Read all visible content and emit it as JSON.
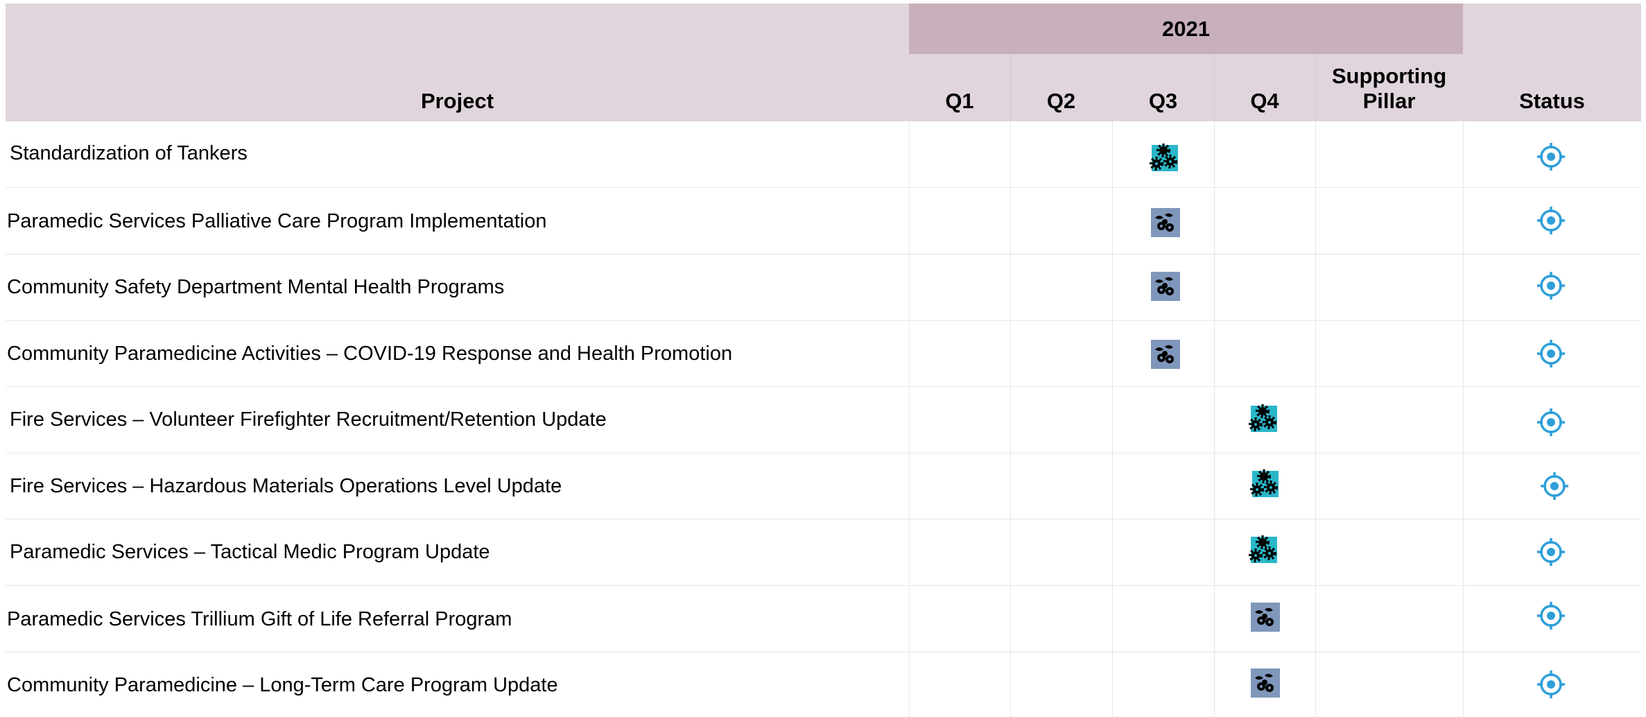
{
  "header": {
    "year": "2021",
    "project": "Project",
    "quarters": [
      "Q1",
      "Q2",
      "Q3",
      "Q4"
    ],
    "pillar_line1": "Supporting",
    "pillar_line2": "Pillar",
    "status": "Status"
  },
  "rows": [
    {
      "project": "Standardization of Tankers",
      "quarter": "Q3",
      "icon": "gears-icon"
    },
    {
      "project": "Paramedic Services Palliative Care Program Implementation",
      "quarter": "Q3",
      "icon": "people-care-icon"
    },
    {
      "project": "Community Safety Department Mental Health Programs",
      "quarter": "Q3",
      "icon": "people-care-icon"
    },
    {
      "project": "Community Paramedicine Activities – COVID-19 Response and Health Promotion",
      "quarter": "Q3",
      "icon": "people-care-icon"
    },
    {
      "project": "Fire Services – Volunteer Firefighter Recruitment/Retention Update",
      "quarter": "Q4",
      "icon": "gears-icon"
    },
    {
      "project": "Fire Services – Hazardous Materials Operations Level Update",
      "quarter": "Q4",
      "icon": "gears-icon"
    },
    {
      "project": "Paramedic Services – Tactical Medic Program Update",
      "quarter": "Q4",
      "icon": "gears-icon"
    },
    {
      "project": "Paramedic Services Trillium Gift of Life Referral Program",
      "quarter": "Q4",
      "icon": "people-care-icon"
    },
    {
      "project": "Community Paramedicine – Long-Term Care Program Update",
      "quarter": "Q4",
      "icon": "people-care-icon"
    }
  ],
  "colors": {
    "header_bg": "#e1d5dd",
    "year_bg": "#c8afbc",
    "gears_icon_bg": "#2ab7c9",
    "people_icon_bg": "#7f97bb",
    "status_icon": "#2f9fd8"
  },
  "status_icon": "target-icon"
}
